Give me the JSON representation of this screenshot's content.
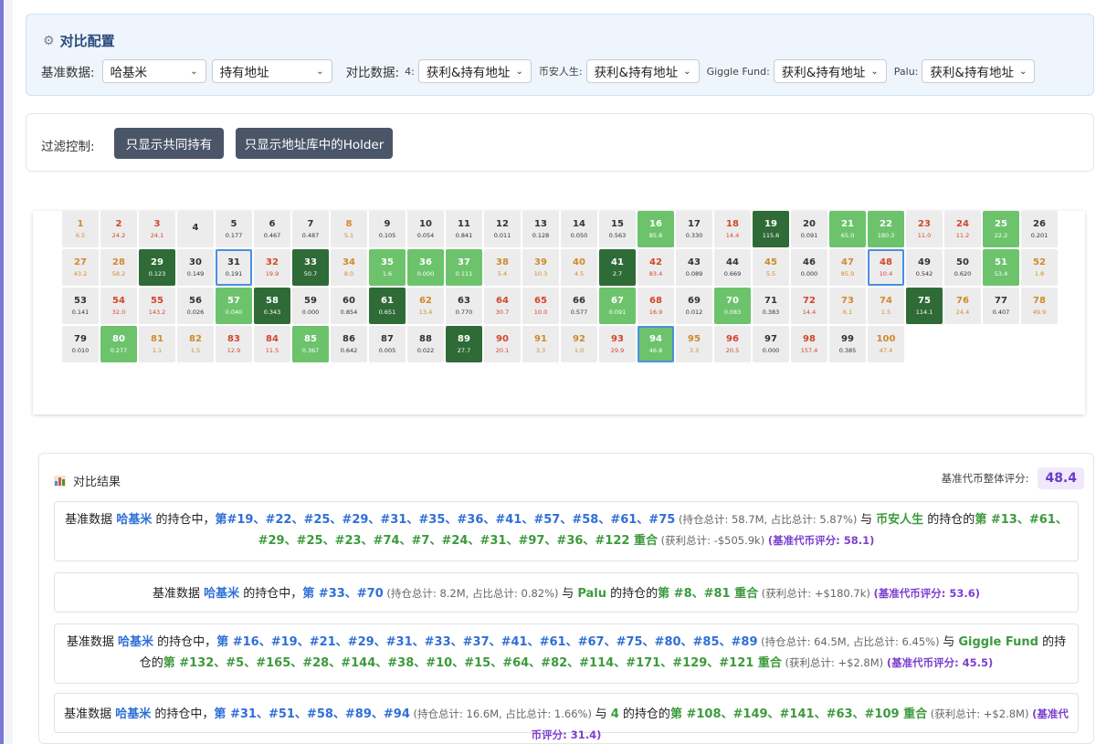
{
  "config": {
    "title": "对比配置",
    "base_label": "基准数据:",
    "base_token": "哈基米",
    "base_mode": "持有地址",
    "compare_label": "对比数据:",
    "compares": [
      {
        "name": "4:",
        "mode": "获利&持有地址"
      },
      {
        "name": "币安人生:",
        "mode": "获利&持有地址"
      },
      {
        "name": "Giggle Fund:",
        "mode": "获利&持有地址"
      },
      {
        "name": "Palu:",
        "mode": "获利&持有地址"
      }
    ]
  },
  "filter": {
    "label": "过滤控制:",
    "btn_common": "只显示共同持有",
    "btn_library": "只显示地址库中的Holder"
  },
  "colors": {
    "dark_green": "#2f6b37",
    "light_green": "#6cc36c",
    "grey_cell": "#ececec",
    "orange_text": "#d08a2a",
    "red_text": "#d5452b",
    "accent_blue": "#2f6fd6",
    "accent_purple": "#7c3fd0"
  },
  "grid": {
    "cells": [
      {
        "r": "1",
        "v": "6.5",
        "s": "o"
      },
      {
        "r": "2",
        "v": "24.2",
        "s": "r"
      },
      {
        "r": "3",
        "v": "24.1",
        "s": "r"
      },
      {
        "r": "4",
        "v": "",
        "s": "g"
      },
      {
        "r": "5",
        "v": "0.177",
        "s": "g"
      },
      {
        "r": "6",
        "v": "0.467",
        "s": "g"
      },
      {
        "r": "7",
        "v": "0.487",
        "s": "g"
      },
      {
        "r": "8",
        "v": "5.1",
        "s": "o"
      },
      {
        "r": "9",
        "v": "0.105",
        "s": "g"
      },
      {
        "r": "10",
        "v": "0.054",
        "s": "g"
      },
      {
        "r": "11",
        "v": "0.841",
        "s": "g"
      },
      {
        "r": "12",
        "v": "0.011",
        "s": "g"
      },
      {
        "r": "13",
        "v": "0.128",
        "s": "g"
      },
      {
        "r": "14",
        "v": "0.050",
        "s": "g"
      },
      {
        "r": "15",
        "v": "0.563",
        "s": "g"
      },
      {
        "r": "16",
        "v": "85.8",
        "s": "lg"
      },
      {
        "r": "17",
        "v": "0.330",
        "s": "g"
      },
      {
        "r": "18",
        "v": "14.4",
        "s": "r"
      },
      {
        "r": "19",
        "v": "115.6",
        "s": "dg"
      },
      {
        "r": "20",
        "v": "0.091",
        "s": "g"
      },
      {
        "r": "21",
        "v": "65.0",
        "s": "lg"
      },
      {
        "r": "22",
        "v": "180.3",
        "s": "lg"
      },
      {
        "r": "23",
        "v": "11.0",
        "s": "r"
      },
      {
        "r": "24",
        "v": "11.2",
        "s": "r"
      },
      {
        "r": "25",
        "v": "22.2",
        "s": "lg"
      },
      {
        "r": "26",
        "v": "0.201",
        "s": "g"
      },
      {
        "r": "27",
        "v": "43.2",
        "s": "o"
      },
      {
        "r": "28",
        "v": "58.2",
        "s": "o"
      },
      {
        "r": "29",
        "v": "0.123",
        "s": "dg"
      },
      {
        "r": "30",
        "v": "0.149",
        "s": "g"
      },
      {
        "r": "31",
        "v": "0.191",
        "s": "g",
        "sel": true
      },
      {
        "r": "32",
        "v": "19.9",
        "s": "r"
      },
      {
        "r": "33",
        "v": "50.7",
        "s": "dg"
      },
      {
        "r": "34",
        "v": "8.0",
        "s": "o"
      },
      {
        "r": "35",
        "v": "1.6",
        "s": "lg"
      },
      {
        "r": "36",
        "v": "0.000",
        "s": "lg"
      },
      {
        "r": "37",
        "v": "0.111",
        "s": "lg"
      },
      {
        "r": "38",
        "v": "5.4",
        "s": "o"
      },
      {
        "r": "39",
        "v": "10.3",
        "s": "o"
      },
      {
        "r": "40",
        "v": "4.5",
        "s": "o"
      },
      {
        "r": "41",
        "v": "2.7",
        "s": "dg"
      },
      {
        "r": "42",
        "v": "83.4",
        "s": "r"
      },
      {
        "r": "43",
        "v": "0.089",
        "s": "g"
      },
      {
        "r": "44",
        "v": "0.669",
        "s": "g"
      },
      {
        "r": "45",
        "v": "5.5",
        "s": "o"
      },
      {
        "r": "46",
        "v": "0.000",
        "s": "g"
      },
      {
        "r": "47",
        "v": "85.9",
        "s": "o"
      },
      {
        "r": "48",
        "v": "10.4",
        "s": "r",
        "sel": true
      },
      {
        "r": "49",
        "v": "0.542",
        "s": "g"
      },
      {
        "r": "50",
        "v": "0.620",
        "s": "g"
      },
      {
        "r": "51",
        "v": "53.4",
        "s": "lg"
      },
      {
        "r": "52",
        "v": "1.8",
        "s": "o"
      },
      {
        "r": "53",
        "v": "0.141",
        "s": "g"
      },
      {
        "r": "54",
        "v": "32.0",
        "s": "r"
      },
      {
        "r": "55",
        "v": "143.2",
        "s": "r"
      },
      {
        "r": "56",
        "v": "0.026",
        "s": "g"
      },
      {
        "r": "57",
        "v": "0.040",
        "s": "lg"
      },
      {
        "r": "58",
        "v": "0.343",
        "s": "dg"
      },
      {
        "r": "59",
        "v": "0.000",
        "s": "g"
      },
      {
        "r": "60",
        "v": "0.854",
        "s": "g"
      },
      {
        "r": "61",
        "v": "0.651",
        "s": "dg"
      },
      {
        "r": "62",
        "v": "13.4",
        "s": "o"
      },
      {
        "r": "63",
        "v": "0.770",
        "s": "g"
      },
      {
        "r": "64",
        "v": "30.7",
        "s": "r"
      },
      {
        "r": "65",
        "v": "10.0",
        "s": "r"
      },
      {
        "r": "66",
        "v": "0.577",
        "s": "g"
      },
      {
        "r": "67",
        "v": "0.091",
        "s": "lg"
      },
      {
        "r": "68",
        "v": "16.9",
        "s": "r"
      },
      {
        "r": "69",
        "v": "0.012",
        "s": "g"
      },
      {
        "r": "70",
        "v": "0.083",
        "s": "lg"
      },
      {
        "r": "71",
        "v": "0.383",
        "s": "g"
      },
      {
        "r": "72",
        "v": "14.4",
        "s": "r"
      },
      {
        "r": "73",
        "v": "6.1",
        "s": "o"
      },
      {
        "r": "74",
        "v": "1.5",
        "s": "o"
      },
      {
        "r": "75",
        "v": "114.1",
        "s": "dg"
      },
      {
        "r": "76",
        "v": "24.4",
        "s": "o"
      },
      {
        "r": "77",
        "v": "0.407",
        "s": "g"
      },
      {
        "r": "78",
        "v": "49.9",
        "s": "o"
      },
      {
        "r": "79",
        "v": "0.010",
        "s": "g"
      },
      {
        "r": "80",
        "v": "0.277",
        "s": "lg"
      },
      {
        "r": "81",
        "v": "1.1",
        "s": "o"
      },
      {
        "r": "82",
        "v": "1.5",
        "s": "o"
      },
      {
        "r": "83",
        "v": "12.9",
        "s": "r"
      },
      {
        "r": "84",
        "v": "11.5",
        "s": "r"
      },
      {
        "r": "85",
        "v": "0.367",
        "s": "lg"
      },
      {
        "r": "86",
        "v": "0.642",
        "s": "g"
      },
      {
        "r": "87",
        "v": "0.005",
        "s": "g"
      },
      {
        "r": "88",
        "v": "0.022",
        "s": "g"
      },
      {
        "r": "89",
        "v": "27.7",
        "s": "dg"
      },
      {
        "r": "90",
        "v": "20.1",
        "s": "r"
      },
      {
        "r": "91",
        "v": "3.3",
        "s": "o"
      },
      {
        "r": "92",
        "v": "1.0",
        "s": "o"
      },
      {
        "r": "93",
        "v": "29.9",
        "s": "r"
      },
      {
        "r": "94",
        "v": "46.8",
        "s": "lg",
        "sel": true
      },
      {
        "r": "95",
        "v": "3.3",
        "s": "o"
      },
      {
        "r": "96",
        "v": "20.5",
        "s": "r"
      },
      {
        "r": "97",
        "v": "0.000",
        "s": "g"
      },
      {
        "r": "98",
        "v": "157.4",
        "s": "r"
      },
      {
        "r": "99",
        "v": "0.385",
        "s": "g"
      },
      {
        "r": "100",
        "v": "47.4",
        "s": "o"
      }
    ]
  },
  "results": {
    "title": "对比结果",
    "overall_label": "基准代币整体评分:",
    "overall_score": "48.4",
    "cards": [
      {
        "p1": "基准数据 ",
        "base": "哈基米",
        "p2": " 的持仓中，",
        "di1": "第",
        "base_ranks": "#19、#22、#25、#29、#31、#35、#36、#41、#57、#58、#61、#75",
        "hold_stats": " (持仓总计: 58.7M, 占比总计: 5.87%) ",
        "p3": "与 ",
        "target": "币安人生",
        "p4": " 的持仓的",
        "di2": "第",
        "target_ranks": " #13、#61、#29、#25、#23、#74、#7、#24、#31、#97、#36、#122 ",
        "overlap": "重合",
        "profit": " (获利总计: -$505.9k) ",
        "score": "(基准代币评分: 58.1)"
      },
      {
        "p1": "基准数据 ",
        "base": "哈基米",
        "p2": " 的持仓中，",
        "di1": "第",
        "base_ranks": " #33、#70",
        "hold_stats": " (持仓总计: 8.2M, 占比总计: 0.82%) ",
        "p3": "与 ",
        "target": "Palu",
        "p4": " 的持仓的",
        "di2": "第",
        "target_ranks": " #8、#81 ",
        "overlap": "重合",
        "profit": " (获利总计: +$180.7k) ",
        "score": "(基准代币评分: 53.6)"
      },
      {
        "p1": "基准数据 ",
        "base": "哈基米",
        "p2": " 的持仓中，",
        "di1": "第",
        "base_ranks": " #16、#19、#21、#29、#31、#33、#37、#41、#61、#67、#75、#80、#85、#89",
        "hold_stats": " (持仓总计: 64.5M, 占比总计: 6.45%) ",
        "p3": "与 ",
        "target": "Giggle Fund",
        "p4": " 的持仓的",
        "di2": "第",
        "target_ranks": " #132、#5、#165、#28、#144、#38、#10、#15、#64、#82、#114、#171、#129、#121 ",
        "overlap": "重合",
        "profit": " (获利总计: +$2.8M) ",
        "score": "(基准代币评分: 45.5)"
      },
      {
        "p1": "基准数据 ",
        "base": "哈基米",
        "p2": " 的持仓中，",
        "di1": "第",
        "base_ranks": " #31、#51、#58、#89、#94",
        "hold_stats": " (持仓总计: 16.6M, 占比总计: 1.66%) ",
        "p3": "与 ",
        "target": "4",
        "p4": " 的持仓的",
        "di2": "第",
        "target_ranks": " #108、#149、#141、#63、#109 ",
        "overlap": "重合",
        "profit": " (获利总计: +$2.8M) ",
        "score": "(基准代币评分: 31.4)"
      }
    ]
  }
}
